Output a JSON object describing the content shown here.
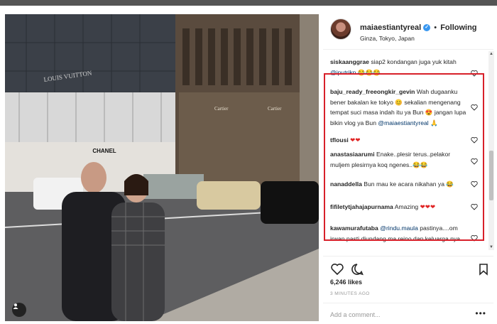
{
  "post": {
    "username": "maiaestiantyreal",
    "follow_state": "Following",
    "location": "Ginza, Tokyo, Japan",
    "verified_symbol": "✓",
    "separator": "•"
  },
  "photo": {
    "sign_chanel": "CHANEL",
    "sign_cartier": "Cartier",
    "sign_cartier_2": "Cartier",
    "sign_louis": "LOUIS VUITTON"
  },
  "comments": [
    {
      "user": "siskaanggrae",
      "text": "siap2 kondangan juga yuk kitah",
      "mention": "@iputrikn",
      "emoji": "😂😂😂"
    },
    {
      "user": "baju_ready_freeongkir_gevin",
      "text": "Wah dugaanku bener bakalan ke tokyo 😊 sekalian mengenang tempat suci masa indah itu ya Bun 😍 jangan lupa bikin vlog ya Bun",
      "mention": "@maiaestiantyreal",
      "emoji": "🙏"
    },
    {
      "user": "tflousi",
      "text": "",
      "emoji": "❤❤"
    },
    {
      "user": "anastasiaarumi",
      "text": "Enake..plesir terus..pelakor muljem plesirnya koq ngenes..😂😂"
    },
    {
      "user": "nanaddella",
      "text": "Bun mau ke acara nikahan ya 😂"
    },
    {
      "user": "fifiletytjahajapurnama",
      "text": "Amazing",
      "emoji": "❤❤❤"
    },
    {
      "user": "kawamurafutaba",
      "mention": "@rindu.maula",
      "text": "pastinya....om irwan pasti diundang ma reino dan keluarga nya ."
    }
  ],
  "likes": "6,246 likes",
  "time": "3 MINUTES AGO",
  "add_comment": {
    "placeholder": "Add a comment..."
  },
  "more_symbol": "•••",
  "scroll": {
    "up": "▲",
    "down": "▼"
  },
  "icons": {
    "heart": "heart-icon",
    "comment": "comment-icon",
    "bookmark": "bookmark-icon",
    "user_tag": "user-tag-icon"
  },
  "colors": {
    "highlight": "#d8202a",
    "verified": "#3897f0",
    "mention": "#003569"
  }
}
